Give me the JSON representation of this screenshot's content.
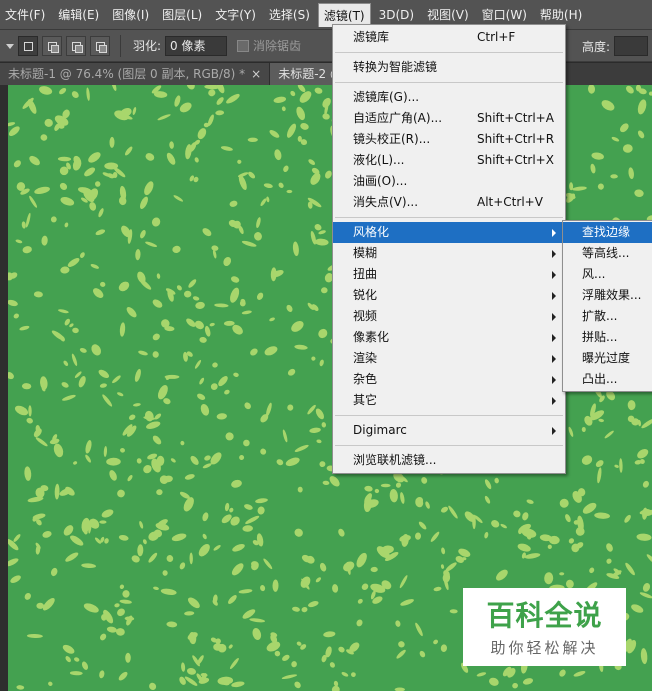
{
  "menubar": {
    "items": [
      "文件(F)",
      "编辑(E)",
      "图像(I)",
      "图层(L)",
      "文字(Y)",
      "选择(S)",
      "滤镜(T)",
      "3D(D)",
      "视图(V)",
      "窗口(W)",
      "帮助(H)"
    ]
  },
  "options": {
    "feather_label": "羽化:",
    "feather_value": "0 像素",
    "antialias_label": "消除锯齿",
    "height_label": "高度:"
  },
  "tabs": [
    {
      "label": "未标题-1 @ 76.4% (图层 0 副本, RGB/8) *",
      "close": "×"
    },
    {
      "label": "未标题-2 @",
      "close": "×"
    }
  ],
  "filter_menu": {
    "group1": [
      {
        "label": "滤镜库",
        "shortcut": "Ctrl+F"
      }
    ],
    "group2": [
      {
        "label": "转换为智能滤镜"
      }
    ],
    "group3": [
      {
        "label": "滤镜库(G)..."
      },
      {
        "label": "自适应广角(A)...",
        "shortcut": "Shift+Ctrl+A"
      },
      {
        "label": "镜头校正(R)...",
        "shortcut": "Shift+Ctrl+R"
      },
      {
        "label": "液化(L)...",
        "shortcut": "Shift+Ctrl+X"
      },
      {
        "label": "油画(O)..."
      },
      {
        "label": "消失点(V)...",
        "shortcut": "Alt+Ctrl+V"
      }
    ],
    "group4": [
      {
        "label": "风格化"
      },
      {
        "label": "模糊"
      },
      {
        "label": "扭曲"
      },
      {
        "label": "锐化"
      },
      {
        "label": "视频"
      },
      {
        "label": "像素化"
      },
      {
        "label": "渲染"
      },
      {
        "label": "杂色"
      },
      {
        "label": "其它"
      }
    ],
    "group5": [
      {
        "label": "Digimarc"
      }
    ],
    "group6": [
      {
        "label": "浏览联机滤镜..."
      }
    ]
  },
  "stylize_submenu": [
    "查找边缘",
    "等高线...",
    "风...",
    "浮雕效果...",
    "扩散...",
    "拼贴...",
    "曝光过度",
    "凸出..."
  ],
  "watermark": {
    "title": "百科全说",
    "subtitle": "助你轻松解决"
  },
  "colors": {
    "canvas": "#44a150",
    "blob": "#a8d66c",
    "highlight": "#1e6fc3"
  }
}
